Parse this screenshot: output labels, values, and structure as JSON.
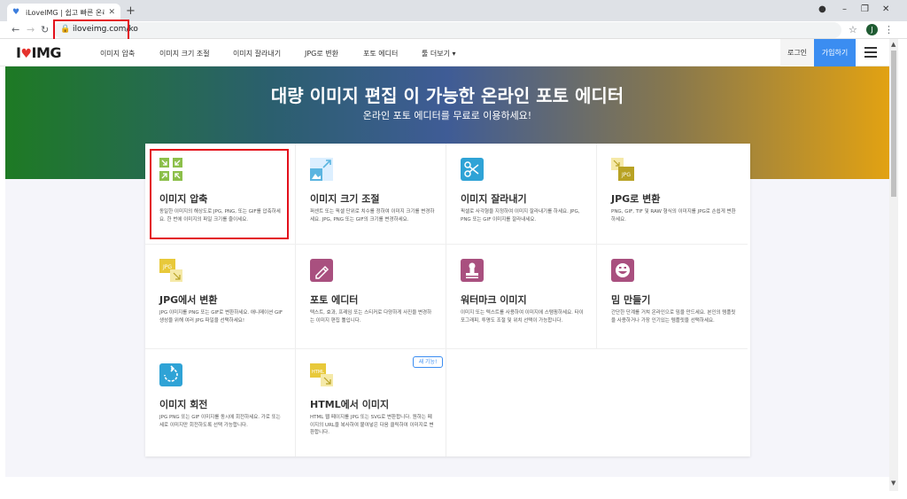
{
  "browser": {
    "tab_title": "iLoveIMG | 쉽고 빠른 온라인 무",
    "url": "iloveimg.com/ko",
    "profile_initial": "J"
  },
  "header": {
    "logo_text": "I",
    "logo_text2": "IMG",
    "menu": [
      "이미지 압축",
      "이미지 크기 조절",
      "이미지 잘라내기",
      "JPG로 변환",
      "포토 에디터",
      "툴 더보기 ▾"
    ],
    "login": "로그인",
    "signup": "가입하기"
  },
  "hero": {
    "title": "대량 이미지 편집 이 가능한 온라인 포토 에디터",
    "subtitle": "온라인 포토 에디터를 무료로 이용하세요!"
  },
  "tools": [
    {
      "title": "이미지 압축",
      "desc": "동일한 이미지의 해상도로 JPG, PNG, 또는 GIF를 압축하세요. 한 번에 이미지의 파일 크기를 줄이세요.",
      "color": "#8cbf4a",
      "icon": "compress-icon"
    },
    {
      "title": "이미지 크기 조절",
      "desc": "퍼센트 또는 픽셀 단위로 치수를 정하여 이미지 크기를 변경하세요. JPG, PNG 또는 GIF의 크기를 변경하세요.",
      "color": "#5bb5e0",
      "icon": "resize-icon"
    },
    {
      "title": "이미지 잘라내기",
      "desc": "픽셀로 사각형을 지정하여 이미지 잘라내기를 하세요. JPG, PNG 또는 GIF 이미지를 잘라내세요.",
      "color": "#2fa3d6",
      "icon": "crop-icon"
    },
    {
      "title": "JPG로 변환",
      "desc": "PNG, GIF, TIF 및 RAW 형식의 이미지를 JPG로 손쉽게 변환하세요.",
      "color": "#e8c93a",
      "icon": "convert-to-jpg-icon"
    },
    {
      "title": "JPG에서 변환",
      "desc": "JPG 이미지를 PNG 또는 GIF로 변환하세요. 애니메이션 GIF 생성을 위해 여러 JPG 파일을 선택하세요!",
      "color": "#e8c93a",
      "icon": "convert-from-jpg-icon"
    },
    {
      "title": "포토 에디터",
      "desc": "텍스트, 효과, 프레임 또는 스티커로 다양하게 사진을 변경하는 이미지 편집 툴입니다.",
      "color": "#a9507f",
      "icon": "photo-editor-icon"
    },
    {
      "title": "워터마크 이미지",
      "desc": "이미지 또는 텍스트를 사용하여 이미지에 스탬핑하세요. 타이포그래피, 투명도 조절 및 위치 선택이 가능합니다.",
      "color": "#a9507f",
      "icon": "watermark-icon"
    },
    {
      "title": "밈 만들기",
      "desc": "간단한 단계를 거쳐 온라인으로 밈을 만드세요. 본인의 템플릿을 사용하거나 가장 인기있는 템플릿을 선택하세요.",
      "color": "#a9507f",
      "icon": "meme-icon"
    },
    {
      "title": "이미지 회전",
      "desc": "JPG PNG 또는 GIF 이미지를 동시에 회전하세요. 가로 또는 세로 이미지만 회전하도록 선택 가능합니다.",
      "color": "#2fa3d6",
      "icon": "rotate-icon"
    },
    {
      "title": "HTML에서 이미지",
      "desc": "HTML 웹 페이지를 JPG 또는 SVG로 변환합니다. 원하는 페이지의 URL을 복사하여 붙여넣은 다음 클릭하여 이미지로 변환합니다.",
      "color": "#e8c93a",
      "icon": "html-to-image-icon"
    }
  ],
  "badge_new": "새 기능!"
}
